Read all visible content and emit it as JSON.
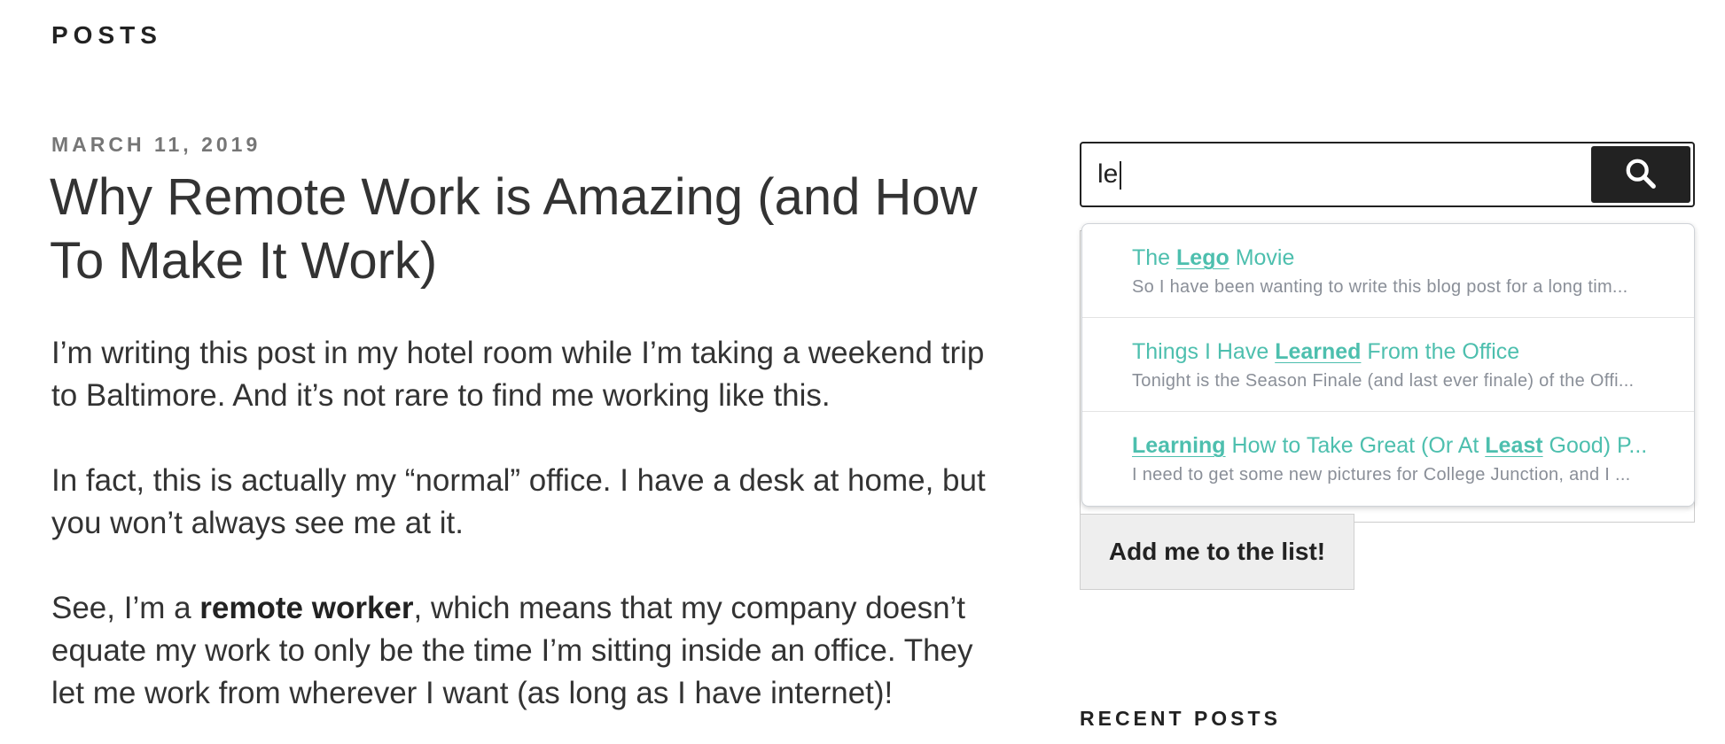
{
  "header": {
    "title": "POSTS"
  },
  "post": {
    "date": "MARCH 11, 2019",
    "title": "Why Remote Work is Amazing (and How To Make It Work)",
    "paragraphs": {
      "p1": "I’m writing this post in my hotel room while I’m taking a weekend trip to Baltimore. And it’s not rare to find me working like this.",
      "p2": "In fact, this is actually my “normal” office. I have a desk at home, but you won’t always see me at it.",
      "p3_pre": "See, I’m a ",
      "p3_bold": "remote worker",
      "p3_post": ", which means that my company doesn’t equate my work to only be the time I’m sitting inside an office. They let me work from wherever I want (as long as I have internet)!"
    }
  },
  "search": {
    "value": "le",
    "button_icon": "search-icon",
    "suggestions": [
      {
        "title_parts": [
          "The ",
          "Lego",
          " Movie"
        ],
        "excerpt": "So I have been wanting to write this blog post for a long tim..."
      },
      {
        "title_parts": [
          "Things I Have ",
          "Learned",
          " From the Office"
        ],
        "excerpt": "Tonight is the Season Finale (and last ever finale) of the Offi..."
      },
      {
        "title_parts": [
          "",
          "Learning",
          " How to Take Great (Or At ",
          "Least",
          " Good) P..."
        ],
        "excerpt": "I need to get some new pictures for College Junction, and I ..."
      }
    ]
  },
  "subscribe": {
    "button_label": "Add me to the list!"
  },
  "sidebar": {
    "recent_heading": "RECENT POSTS"
  },
  "colors": {
    "accent": "#4dbfae",
    "dark": "#222222",
    "muted": "#767676"
  }
}
